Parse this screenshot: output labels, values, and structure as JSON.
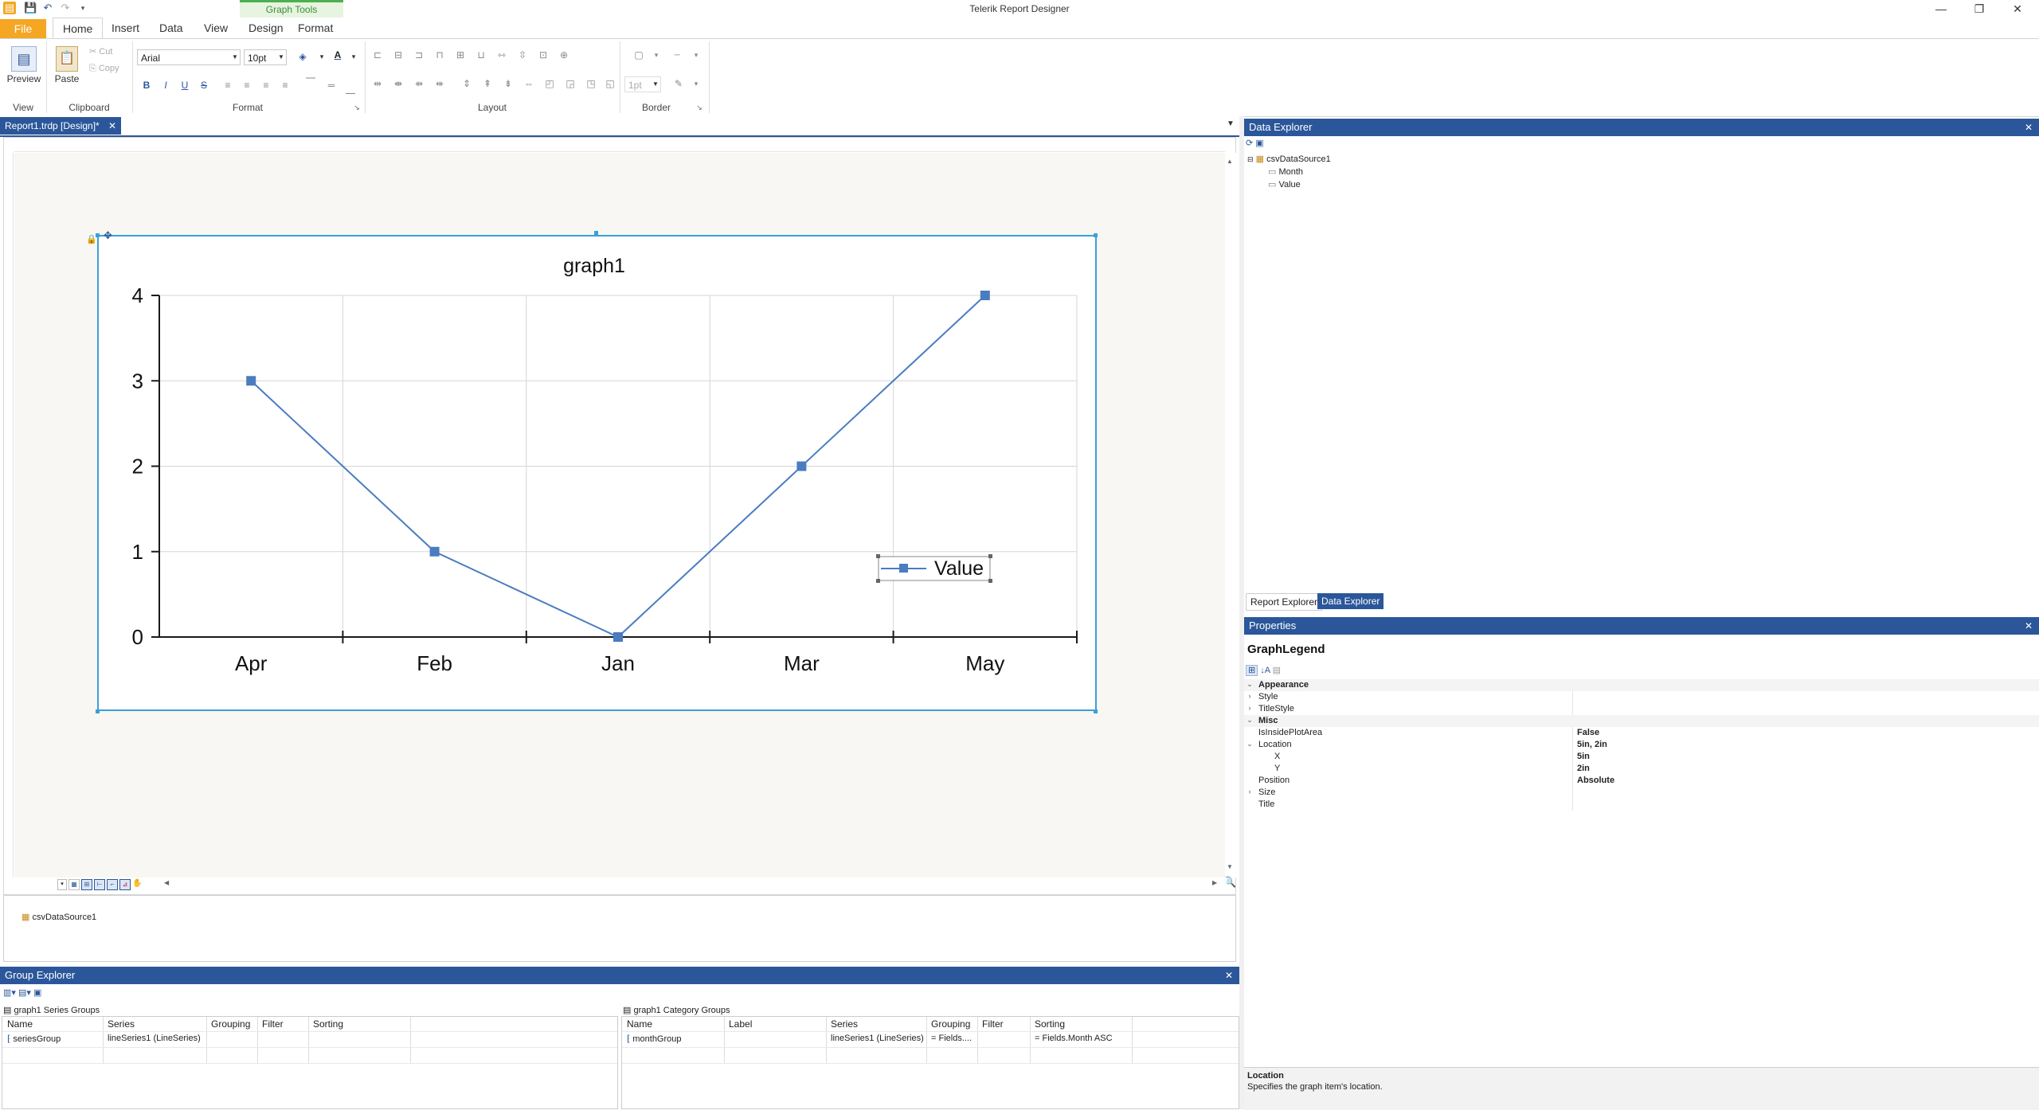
{
  "app": {
    "title": "Telerik Report Designer",
    "contextual_tab_group": "Graph Tools"
  },
  "ribbon": {
    "tabs": [
      "File",
      "Home",
      "Insert",
      "Data",
      "View",
      "Design",
      "Format"
    ],
    "active_tab": "Home",
    "groups": {
      "view": {
        "label": "View",
        "preview": "Preview"
      },
      "clipboard": {
        "label": "Clipboard",
        "paste": "Paste",
        "cut": "Cut",
        "copy": "Copy"
      },
      "format": {
        "label": "Format",
        "font": "Arial",
        "size": "10pt"
      },
      "layout": {
        "label": "Layout"
      },
      "border": {
        "label": "Border",
        "width": "1pt"
      }
    }
  },
  "document": {
    "tab_label": "Report1.trdp [Design]*"
  },
  "chart_data": {
    "type": "line",
    "title": "graph1",
    "categories": [
      "Apr",
      "Feb",
      "Jan",
      "Mar",
      "May"
    ],
    "series": [
      {
        "name": "Value",
        "values": [
          3,
          1,
          0,
          2,
          4
        ]
      }
    ],
    "yticks": [
      "0",
      "1",
      "2",
      "3",
      "4"
    ],
    "ylim": [
      0,
      4
    ],
    "grid": true,
    "legend_position": "right",
    "colors": {
      "line": "#4a7cc0",
      "grid": "#d6d6d6",
      "axis": "#1a1a1a"
    }
  },
  "datasource_strip": {
    "item": "csvDataSource1"
  },
  "data_explorer": {
    "title": "Data Explorer",
    "tree": {
      "root": "csvDataSource1",
      "fields": [
        "Month",
        "Value"
      ]
    },
    "tabs": [
      "Report Explorer",
      "Data Explorer"
    ],
    "active_tab": "Data Explorer"
  },
  "properties": {
    "title": "Properties",
    "object_name": "GraphLegend",
    "rows": [
      {
        "name": "Appearance",
        "value": "",
        "category": true,
        "expanded": true
      },
      {
        "name": "Style",
        "value": "",
        "indent": 1,
        "expandable": true
      },
      {
        "name": "TitleStyle",
        "value": "",
        "indent": 1,
        "expandable": true
      },
      {
        "name": "Misc",
        "value": "",
        "category": true,
        "expanded": true
      },
      {
        "name": "IsInsidePlotArea",
        "value": "False",
        "indent": 1
      },
      {
        "name": "Location",
        "value": "5in, 2in",
        "indent": 1,
        "expanded": true
      },
      {
        "name": "X",
        "value": "5in",
        "indent": 2
      },
      {
        "name": "Y",
        "value": "2in",
        "indent": 2
      },
      {
        "name": "Position",
        "value": "Absolute",
        "indent": 1
      },
      {
        "name": "Size",
        "value": "",
        "indent": 1,
        "expandable": true
      },
      {
        "name": "Title",
        "value": "",
        "indent": 1
      }
    ],
    "description_title": "Location",
    "description_text": "Specifies the graph item's location."
  },
  "group_explorer": {
    "title": "Group Explorer",
    "series_groups": {
      "label": "graph1 Series Groups",
      "columns": [
        "Name",
        "Series",
        "Grouping",
        "Filter",
        "Sorting"
      ],
      "rows": [
        [
          "seriesGroup",
          "lineSeries1 (LineSeries)",
          "",
          "",
          ""
        ]
      ]
    },
    "category_groups": {
      "label": "graph1 Category Groups",
      "columns": [
        "Name",
        "Label",
        "Series",
        "Grouping",
        "Filter",
        "Sorting"
      ],
      "rows": [
        [
          "monthGroup",
          "",
          "lineSeries1 (LineSeries)",
          "= Fields....",
          "",
          "= Fields.Month ASC"
        ]
      ]
    }
  }
}
